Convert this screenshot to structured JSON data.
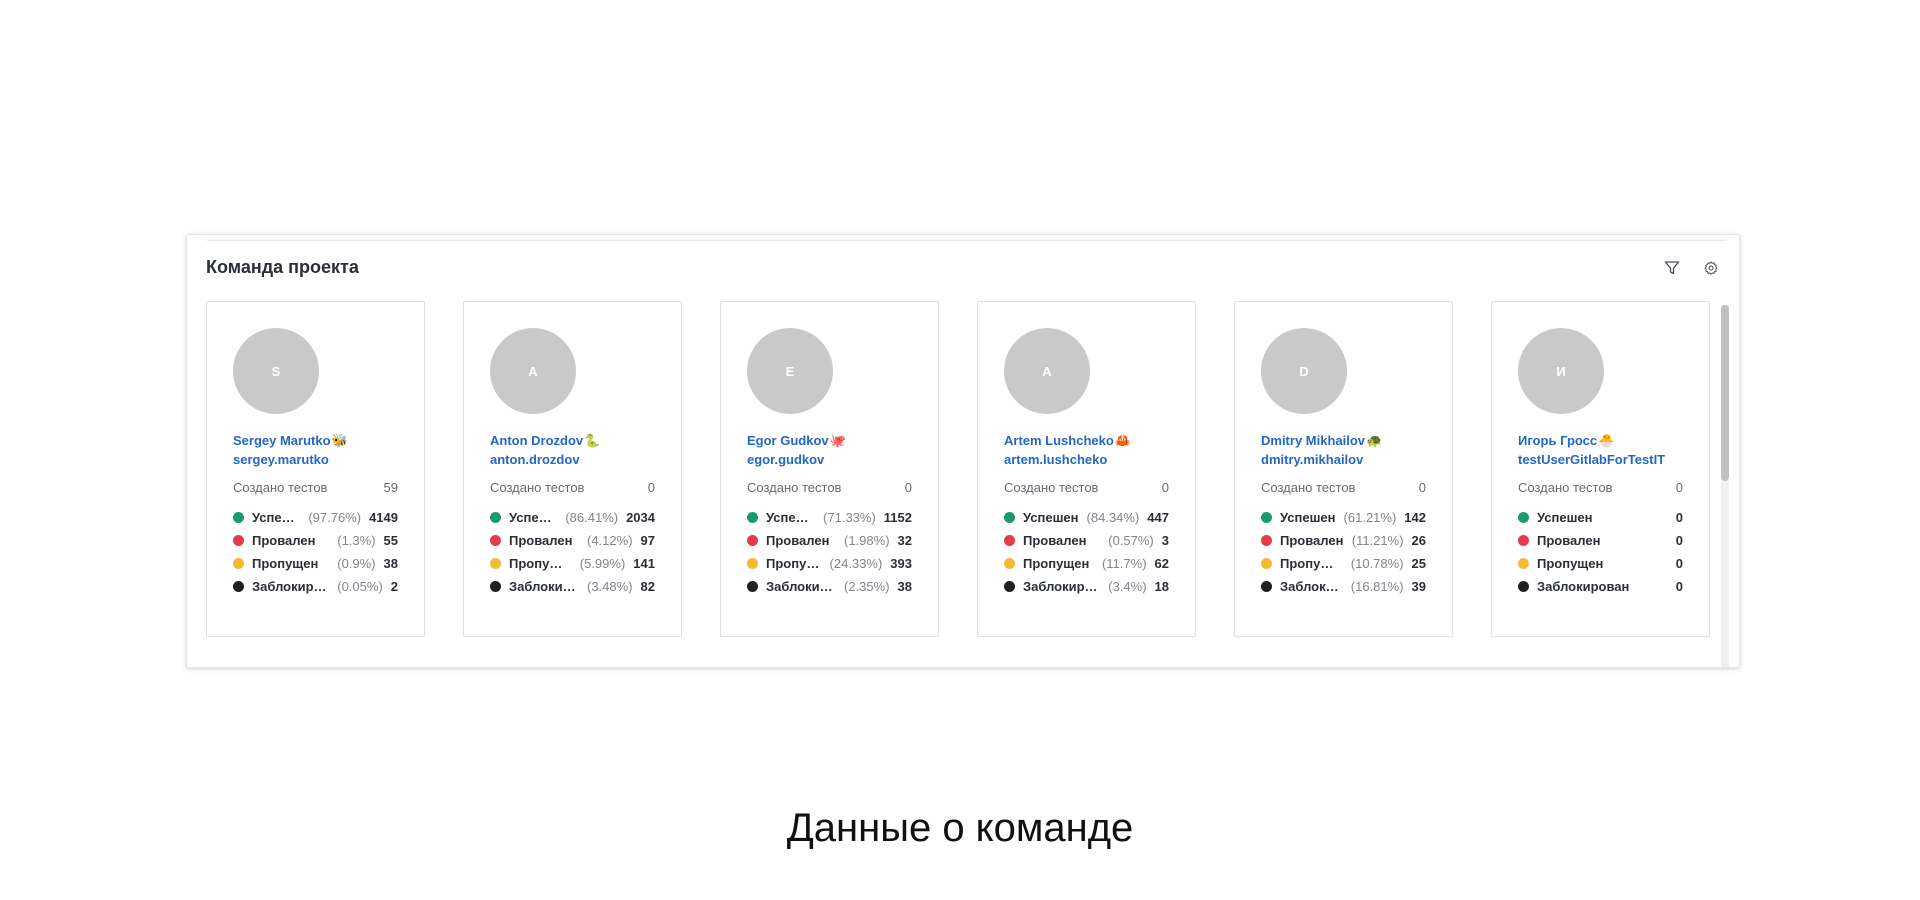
{
  "widget": {
    "title": "Команда проекта",
    "filter_icon": "filter-icon",
    "settings_icon": "gear-icon"
  },
  "created_label": "Создано тестов",
  "colors": {
    "passed": "#1a9b6c",
    "failed": "#e8394a",
    "skipped": "#f5b935",
    "blocked": "#1e2022",
    "link": "#2367c7",
    "avatar": "#c9c9c9"
  },
  "members": [
    {
      "initial": "S",
      "name": "Sergey Marutko",
      "emoji": "🐝",
      "login": "sergey.marutko",
      "created": "59",
      "stats": [
        {
          "label": "Успешен",
          "pct": "(97.76%)",
          "count": "4149"
        },
        {
          "label": "Провален",
          "pct": "(1.3%)",
          "count": "55"
        },
        {
          "label": "Пропущен",
          "pct": "(0.9%)",
          "count": "38"
        },
        {
          "label": "Заблокирован",
          "pct": "(0.05%)",
          "count": "2"
        }
      ]
    },
    {
      "initial": "A",
      "name": "Anton Drozdov",
      "emoji": "🐍",
      "login": "anton.drozdov",
      "created": "0",
      "stats": [
        {
          "label": "Успешен",
          "pct": "(86.41%)",
          "count": "2034"
        },
        {
          "label": "Провален",
          "pct": "(4.12%)",
          "count": "97"
        },
        {
          "label": "Пропущен",
          "pct": "(5.99%)",
          "count": "141"
        },
        {
          "label": "Заблокирован",
          "pct": "(3.48%)",
          "count": "82"
        }
      ]
    },
    {
      "initial": "E",
      "name": "Egor Gudkov",
      "emoji": "🐙",
      "login": "egor.gudkov",
      "created": "0",
      "stats": [
        {
          "label": "Успешен",
          "pct": "(71.33%)",
          "count": "1152"
        },
        {
          "label": "Провален",
          "pct": "(1.98%)",
          "count": "32"
        },
        {
          "label": "Пропущен",
          "pct": "(24.33%)",
          "count": "393"
        },
        {
          "label": "Заблокирован",
          "pct": "(2.35%)",
          "count": "38"
        }
      ]
    },
    {
      "initial": "A",
      "name": "Artem Lushcheko",
      "emoji": "🦀",
      "login": "artem.lushcheko",
      "created": "0",
      "stats": [
        {
          "label": "Успешен",
          "pct": "(84.34%)",
          "count": "447"
        },
        {
          "label": "Провален",
          "pct": "(0.57%)",
          "count": "3"
        },
        {
          "label": "Пропущен",
          "pct": "(11.7%)",
          "count": "62"
        },
        {
          "label": "Заблокирован",
          "pct": "(3.4%)",
          "count": "18"
        }
      ]
    },
    {
      "initial": "D",
      "name": "Dmitry Mikhailov",
      "emoji": "🐢",
      "login": "dmitry.mikhailov",
      "created": "0",
      "stats": [
        {
          "label": "Успешен",
          "pct": "(61.21%)",
          "count": "142"
        },
        {
          "label": "Провален",
          "pct": "(11.21%)",
          "count": "26"
        },
        {
          "label": "Пропущен",
          "pct": "(10.78%)",
          "count": "25"
        },
        {
          "label": "Заблокирован",
          "pct": "(16.81%)",
          "count": "39"
        }
      ]
    },
    {
      "initial": "И",
      "name": "Игорь Гросс",
      "emoji": "🐣",
      "login": "testUserGitlabForTestIT",
      "created": "0",
      "stats": [
        {
          "label": "Успешен",
          "pct": "",
          "count": "0"
        },
        {
          "label": "Провален",
          "pct": "",
          "count": "0"
        },
        {
          "label": "Пропущен",
          "pct": "",
          "count": "0"
        },
        {
          "label": "Заблокирован",
          "pct": "",
          "count": "0"
        }
      ]
    }
  ],
  "caption": "Данные о команде"
}
